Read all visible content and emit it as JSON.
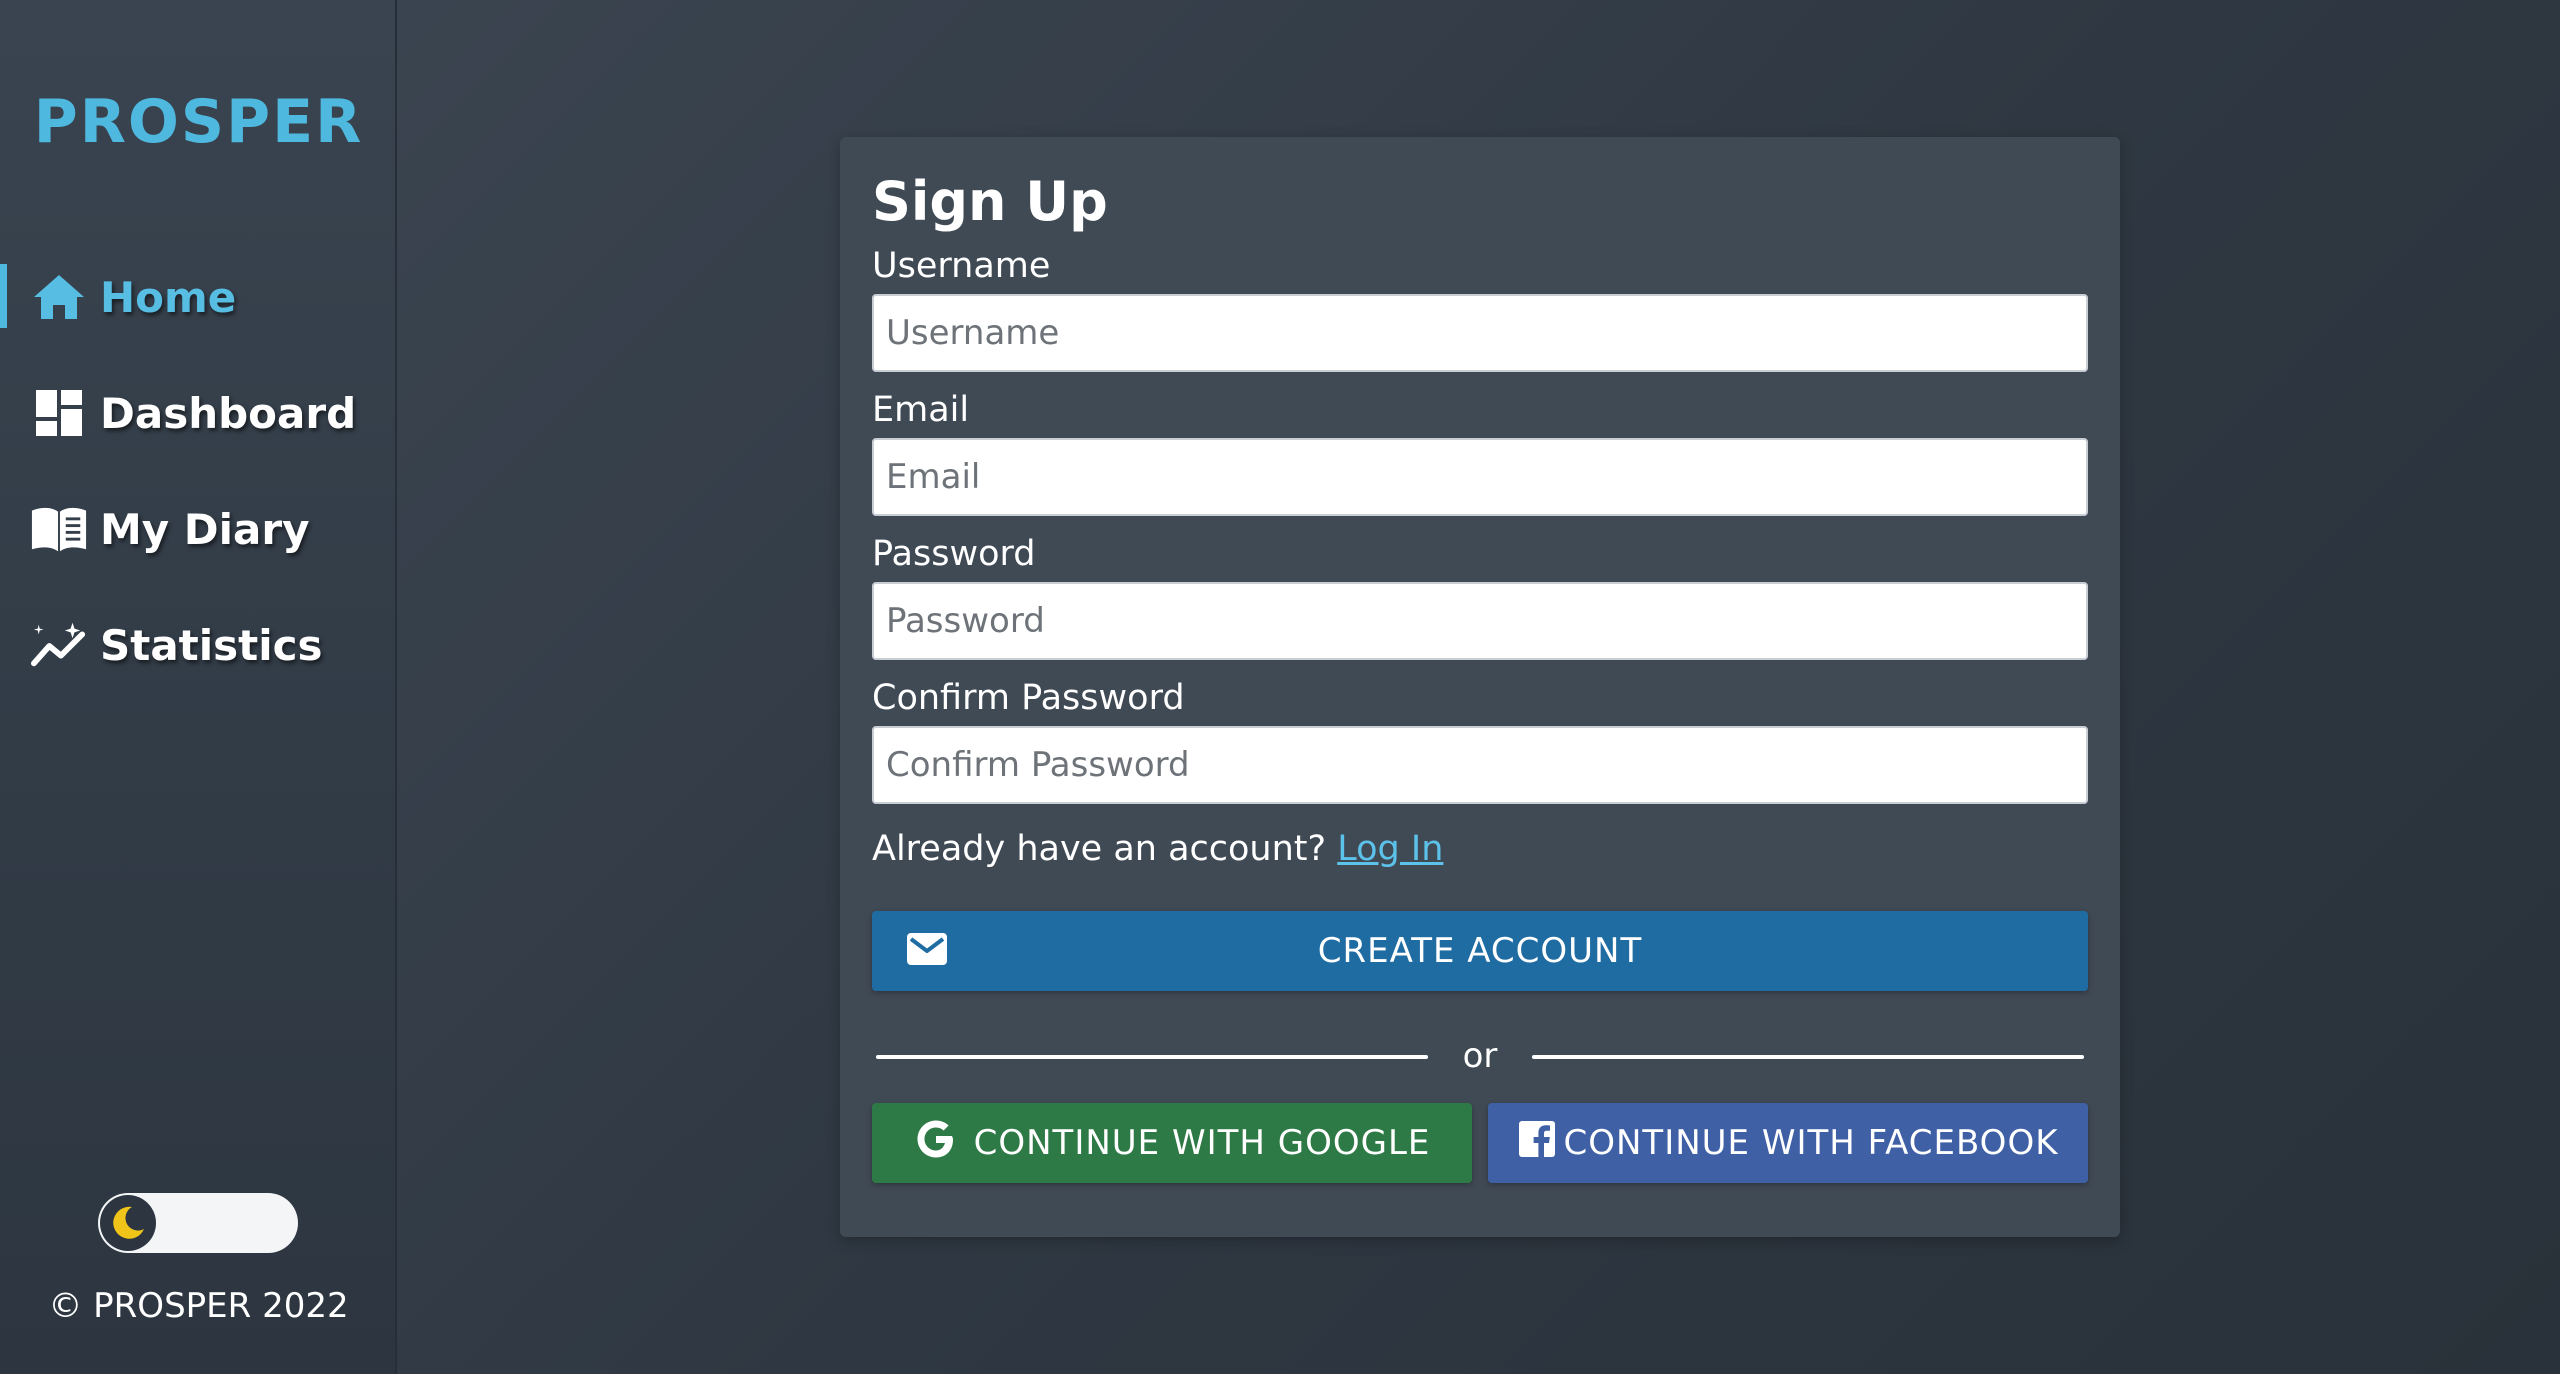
{
  "sidebar": {
    "brand": "PROSPER",
    "items": [
      {
        "label": "Home",
        "icon": "home-icon",
        "active": true
      },
      {
        "label": "Dashboard",
        "icon": "dashboard-icon",
        "active": false
      },
      {
        "label": "My Diary",
        "icon": "book-icon",
        "active": false
      },
      {
        "label": "Statistics",
        "icon": "chart-sparkle-icon",
        "active": false
      }
    ],
    "theme_toggle": {
      "icon": "moon-icon",
      "state": "dark"
    },
    "copyright": "© PROSPER 2022"
  },
  "form": {
    "title": "Sign Up",
    "fields": [
      {
        "label": "Username",
        "placeholder": "Username",
        "value": ""
      },
      {
        "label": "Email",
        "placeholder": "Email",
        "value": ""
      },
      {
        "label": "Password",
        "placeholder": "Password",
        "value": ""
      },
      {
        "label": "Confirm Password",
        "placeholder": "Confirm Password",
        "value": ""
      }
    ],
    "login_prompt": "Already have an account?",
    "login_link": "Log In",
    "create_button": "CREATE ACCOUNT",
    "create_icon": "mail-icon",
    "divider_text": "or",
    "google_button": "CONTINUE WITH GOOGLE",
    "google_icon": "google-icon",
    "facebook_button": "CONTINUE WITH FACEBOOK",
    "facebook_icon": "facebook-icon"
  },
  "colors": {
    "accent": "#4fb8df",
    "create": "#1f6ca3",
    "google": "#2e7a46",
    "facebook": "#4060a6",
    "toggle_moon": "#f0c419"
  }
}
